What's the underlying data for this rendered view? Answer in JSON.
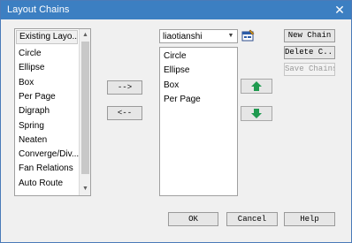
{
  "window": {
    "title": "Layout Chains",
    "close_glyph": "✕"
  },
  "left_list": {
    "header": "Existing Layo...",
    "items": [
      "Circle",
      "Ellipse",
      "Box",
      "Per Page",
      "Digraph",
      "Spring",
      "Neaten",
      "Converge/Div...",
      "Fan Relations",
      "Auto Route"
    ]
  },
  "chain_combo": {
    "value": "liaotianshi"
  },
  "right_list": {
    "items": [
      "Circle",
      "Ellipse",
      "Box",
      "Per Page"
    ]
  },
  "buttons": {
    "add": "-->",
    "remove": "<--",
    "new_chain": "New Chain",
    "delete_chain": "Delete C...",
    "save_chains": "Save Chains",
    "ok": "OK",
    "cancel": "Cancel",
    "help": "Help"
  },
  "colors": {
    "title_bar": "#3c7fc2",
    "move_arrow": "#1f9a4f"
  }
}
